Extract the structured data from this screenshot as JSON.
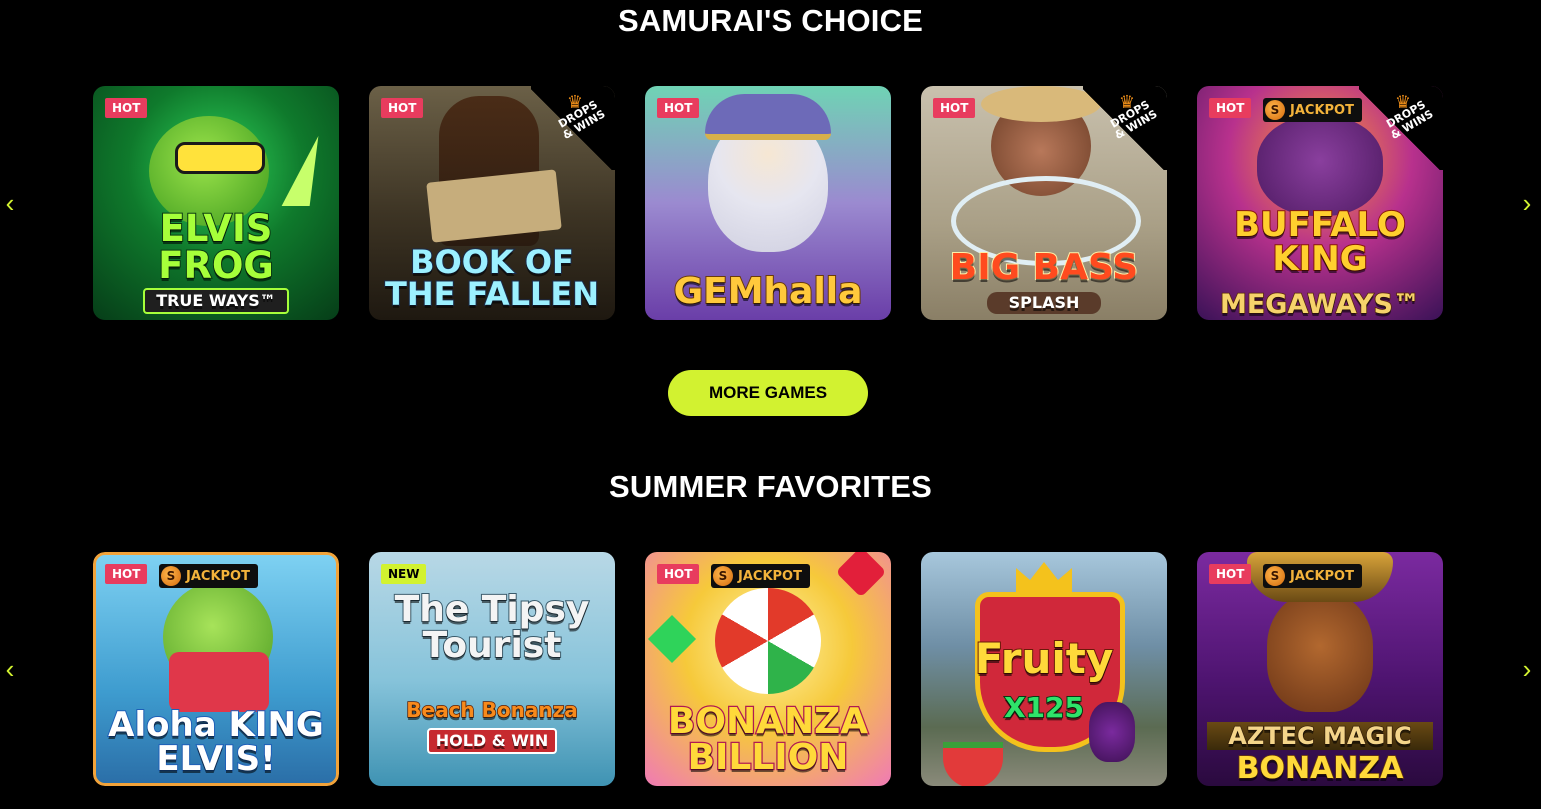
{
  "sections": [
    {
      "title": "SAMURAI'S CHOICE",
      "games": [
        {
          "title": "ELVIS FROG",
          "subtitle": "TRUE WAYS™",
          "tag": "HOT",
          "jackpot": false,
          "drops": false
        },
        {
          "title": "BOOK OF THE FALLEN",
          "subtitle": "™",
          "tag": "HOT",
          "jackpot": false,
          "drops": true
        },
        {
          "title": "GEMhalla",
          "subtitle": "",
          "tag": "HOT",
          "jackpot": false,
          "drops": false
        },
        {
          "title": "BIG BASS",
          "subtitle": "SPLASH",
          "tag": "HOT",
          "jackpot": false,
          "drops": true
        },
        {
          "title": "BUFFALO KING",
          "subtitle": "MEGAWAYS™",
          "tag": "HOT",
          "jackpot": true,
          "drops": true
        }
      ]
    },
    {
      "title": "SUMMER FAVORITES",
      "games": [
        {
          "title": "Aloha KING ELVIS!",
          "subtitle": "",
          "tag": "HOT",
          "jackpot": true,
          "drops": false
        },
        {
          "title": "The Tipsy Tourist",
          "subtitle": "Beach Bonanza",
          "extra": "HOLD & WIN",
          "tag": "NEW",
          "jackpot": false,
          "drops": false
        },
        {
          "title": "BONANZA BILLION",
          "subtitle": "",
          "tag": "HOT",
          "jackpot": true,
          "drops": false
        },
        {
          "title": "Fruity",
          "subtitle": "X125",
          "tag": "",
          "jackpot": false,
          "drops": false
        },
        {
          "title": "AZTEC MAGIC",
          "subtitle": "BONANZA",
          "tag": "HOT",
          "jackpot": true,
          "drops": false
        }
      ]
    }
  ],
  "more_games_label": "MORE GAMES",
  "labels": {
    "jackpot": "JACKPOT",
    "drops": "DROPS & WINS",
    "coin": "S"
  },
  "icons": {
    "prev": "chevron-left-icon",
    "next": "chevron-right-icon",
    "crown": "crown-icon"
  },
  "colors": {
    "accent": "#d2f230",
    "hot": "#e83c5e",
    "background": "#000000",
    "jackpot_text": "#f3b33b"
  }
}
